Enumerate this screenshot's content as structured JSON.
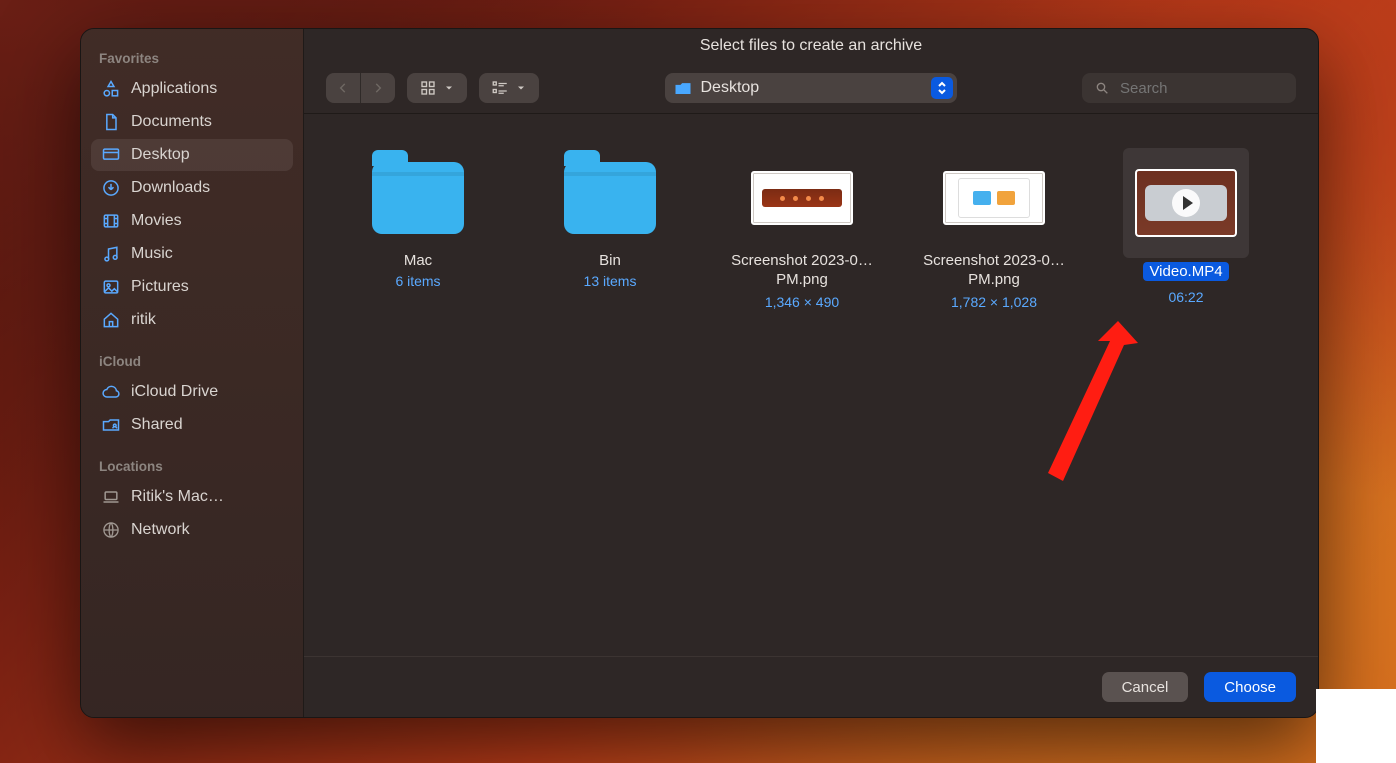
{
  "title": "Select files to create an archive",
  "toolbar": {
    "search_placeholder": "Search",
    "current_folder": "Desktop"
  },
  "sidebar": {
    "sections": [
      {
        "header": "Favorites",
        "items": [
          {
            "label": "Applications",
            "icon": "apps-icon"
          },
          {
            "label": "Documents",
            "icon": "documents-icon"
          },
          {
            "label": "Desktop",
            "icon": "desktop-icon",
            "selected": true
          },
          {
            "label": "Downloads",
            "icon": "downloads-icon"
          },
          {
            "label": "Movies",
            "icon": "movies-icon"
          },
          {
            "label": "Music",
            "icon": "music-icon"
          },
          {
            "label": "Pictures",
            "icon": "pictures-icon"
          },
          {
            "label": "ritik",
            "icon": "home-icon"
          }
        ]
      },
      {
        "header": "iCloud",
        "items": [
          {
            "label": "iCloud Drive",
            "icon": "cloud-icon"
          },
          {
            "label": "Shared",
            "icon": "shared-folder-icon"
          }
        ]
      },
      {
        "header": "Locations",
        "items": [
          {
            "label": "Ritik's Mac…",
            "icon": "laptop-icon",
            "gray": true
          },
          {
            "label": "Network",
            "icon": "globe-icon",
            "gray": true
          }
        ]
      }
    ]
  },
  "files": [
    {
      "name": "Mac",
      "kind": "folder",
      "meta": "6 items"
    },
    {
      "name": "Bin",
      "kind": "folder",
      "meta": "13 items"
    },
    {
      "name": "Screenshot 2023-0…PM.png",
      "kind": "image-orange",
      "meta": "1,346 × 490"
    },
    {
      "name": "Screenshot 2023-0…PM.png",
      "kind": "image-light",
      "meta": "1,782 × 1,028"
    },
    {
      "name": "Video.MP4",
      "kind": "video",
      "meta": "06:22",
      "selected": true
    }
  ],
  "footer": {
    "cancel": "Cancel",
    "choose": "Choose"
  }
}
